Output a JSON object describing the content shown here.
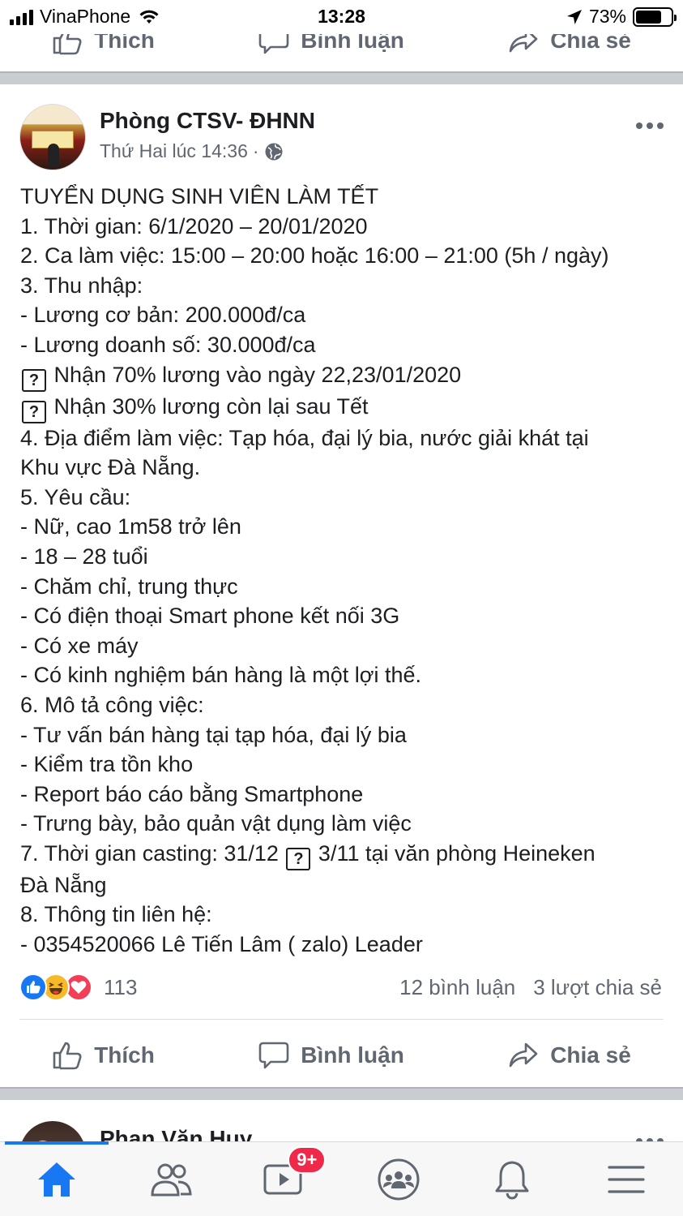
{
  "status_bar": {
    "carrier": "VinaPhone",
    "time": "13:28",
    "battery": "73%",
    "battery_level": 0.73
  },
  "actions": {
    "like": "Thích",
    "comment": "Bình luận",
    "share": "Chia sẻ"
  },
  "post": {
    "author": "Phòng CTSV- ĐHNN",
    "timestamp": "Thứ Hai lúc 14:36",
    "dot": "·",
    "audience_icon": "globe-icon",
    "lines": [
      {
        "text": "TUYỂN DỤNG SINH VIÊN LÀM TẾT"
      },
      {
        "text": "1. Thời gian: 6/1/2020 – 20/01/2020"
      },
      {
        "text": "2. Ca làm việc: 15:00 – 20:00 hoặc 16:00 – 21:00 (5h / ngày)"
      },
      {
        "text": "3. Thu nhập:"
      },
      {
        "text": "- Lương cơ bản: 200.000đ/ca"
      },
      {
        "text": "- Lương doanh số: 30.000đ/ca"
      },
      {
        "box": "?",
        "text": " Nhận 70% lương vào ngày 22,23/01/2020"
      },
      {
        "box": "?",
        "text": " Nhận 30% lương còn lại sau Tết"
      },
      {
        "text": "4. Địa điểm làm việc: Tạp hóa, đại lý bia, nước giải khát tại"
      },
      {
        "text": "Khu vực Đà Nẵng."
      },
      {
        "text": "5. Yêu cầu:"
      },
      {
        "text": "- Nữ, cao 1m58 trở lên"
      },
      {
        "text": "- 18 – 28 tuổi"
      },
      {
        "text": "- Chăm chỉ, trung thực"
      },
      {
        "text": "- Có điện thoại Smart phone kết nối 3G"
      },
      {
        "text": "- Có xe máy"
      },
      {
        "text": "- Có kinh nghiệm bán hàng là một lợi thế."
      },
      {
        "text": "6. Mô tả công việc:"
      },
      {
        "text": "- Tư vấn bán hàng tại tạp hóa, đại lý bia"
      },
      {
        "text": "- Kiểm tra tồn kho"
      },
      {
        "text": "- Report báo cáo bằng Smartphone"
      },
      {
        "text": "- Trưng bày, bảo quản vật dụng làm việc"
      },
      {
        "text": "7. Thời gian casting: 31/12 ",
        "box": "?",
        "after": " 3/11 tại văn phòng Heineken"
      },
      {
        "text": "Đà Nẵng"
      },
      {
        "text": "8. Thông tin liên hệ:"
      },
      {
        "text": "- 0354520066 Lê Tiến Lâm ( zalo) Leader"
      }
    ],
    "reaction_count": "113",
    "comments": "12 bình luận",
    "shares": "3 lượt chia sẻ",
    "reaction_icons": [
      "like-reaction-icon",
      "haha-reaction-icon",
      "love-reaction-icon"
    ]
  },
  "next_post": {
    "author": "Phan Văn Huy"
  },
  "tabbar": {
    "video_badge": "9+",
    "tabs": [
      "home-icon",
      "friends-icon",
      "watch-icon",
      "groups-icon",
      "notifications-icon",
      "menu-icon"
    ],
    "active_color": "#1877f2"
  }
}
